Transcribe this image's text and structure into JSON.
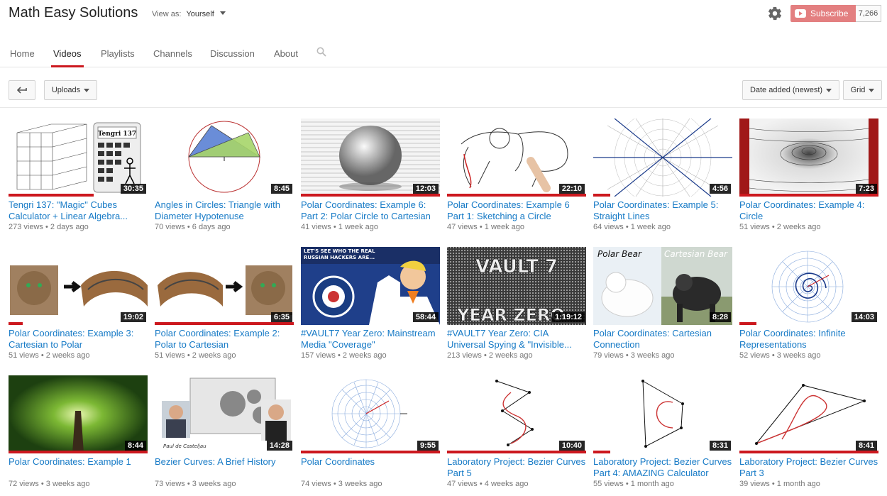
{
  "channel": {
    "title": "Math Easy Solutions",
    "view_as_label": "View as:",
    "view_as_value": "Yourself",
    "subscribe_label": "Subscribe",
    "subscriber_count": "7,266"
  },
  "tabs": [
    {
      "label": "Home"
    },
    {
      "label": "Videos"
    },
    {
      "label": "Playlists"
    },
    {
      "label": "Channels"
    },
    {
      "label": "Discussion"
    },
    {
      "label": "About"
    }
  ],
  "toolbar": {
    "uploads_label": "Uploads",
    "sort_label": "Date added (newest)",
    "view_label": "Grid"
  },
  "videos": [
    {
      "title": "Tengri 137: \"Magic\" Cubes Calculator + Linear Algebra...",
      "views": "273 views",
      "age": "2 days ago",
      "duration": "30:35",
      "thumb_text": "Tengri 137"
    },
    {
      "title": "Angles in Circles: Triangle with Diameter Hypotenuse",
      "views": "70 views",
      "age": "6 days ago",
      "duration": "8:45"
    },
    {
      "title": "Polar Coordinates: Example 6: Part 2: Polar Circle to Cartesian",
      "views": "41 views",
      "age": "1 week ago",
      "duration": "12:03"
    },
    {
      "title": "Polar Coordinates: Example 6 Part 1: Sketching a Circle",
      "views": "47 views",
      "age": "1 week ago",
      "duration": "22:10"
    },
    {
      "title": "Polar Coordinates: Example 5: Straight Lines",
      "views": "64 views",
      "age": "1 week ago",
      "duration": "4:56"
    },
    {
      "title": "Polar Coordinates: Example 4: Circle",
      "views": "51 views",
      "age": "2 weeks ago",
      "duration": "7:23"
    },
    {
      "title": "Polar Coordinates: Example 3: Cartesian to Polar",
      "views": "51 views",
      "age": "2 weeks ago",
      "duration": "19:02"
    },
    {
      "title": "Polar Coordinates: Example 2: Polar to Cartesian",
      "views": "51 views",
      "age": "2 weeks ago",
      "duration": "6:35"
    },
    {
      "title": "#VAULT7 Year Zero: Mainstream Media \"Coverage\"",
      "views": "157 views",
      "age": "2 weeks ago",
      "duration": "58:44",
      "thumb_text": "LET'S SEE WHO THE REAL RUSSIAN HACKERS ARE..."
    },
    {
      "title": "#VAULT7 Year Zero: CIA Universal Spying & \"Invisible...",
      "views": "213 views",
      "age": "2 weeks ago",
      "duration": "1:19:12",
      "thumb_text": "VAULT 7",
      "thumb_text2": "YEAR ZERO"
    },
    {
      "title": "Polar Coordinates: Cartesian Connection",
      "views": "79 views",
      "age": "3 weeks ago",
      "duration": "8:28",
      "thumb_text": "Polar Bear",
      "thumb_text2": "Cartesian Bear"
    },
    {
      "title": "Polar Coordinates: Infinite Representations",
      "views": "52 views",
      "age": "3 weeks ago",
      "duration": "14:03"
    },
    {
      "title": "Polar Coordinates: Example 1",
      "views": "72 views",
      "age": "3 weeks ago",
      "duration": "8:44"
    },
    {
      "title": "Bezier Curves: A Brief History",
      "views": "73 views",
      "age": "3 weeks ago",
      "duration": "14:28",
      "thumb_text": "Paul de Casteljau"
    },
    {
      "title": "Polar Coordinates",
      "views": "74 views",
      "age": "3 weeks ago",
      "duration": "9:55"
    },
    {
      "title": "Laboratory Project: Bezier Curves Part 5",
      "views": "47 views",
      "age": "4 weeks ago",
      "duration": "10:40"
    },
    {
      "title": "Laboratory Project: Bezier Curves Part 4: AMAZING Calculator",
      "views": "55 views",
      "age": "1 month ago",
      "duration": "8:31"
    },
    {
      "title": "Laboratory Project: Bezier Curves Part 3",
      "views": "39 views",
      "age": "1 month ago",
      "duration": "8:41"
    }
  ],
  "colors": {
    "accent_red": "#cc181e",
    "link_blue": "#167ac6",
    "subscribe_bg": "#e37f80"
  }
}
